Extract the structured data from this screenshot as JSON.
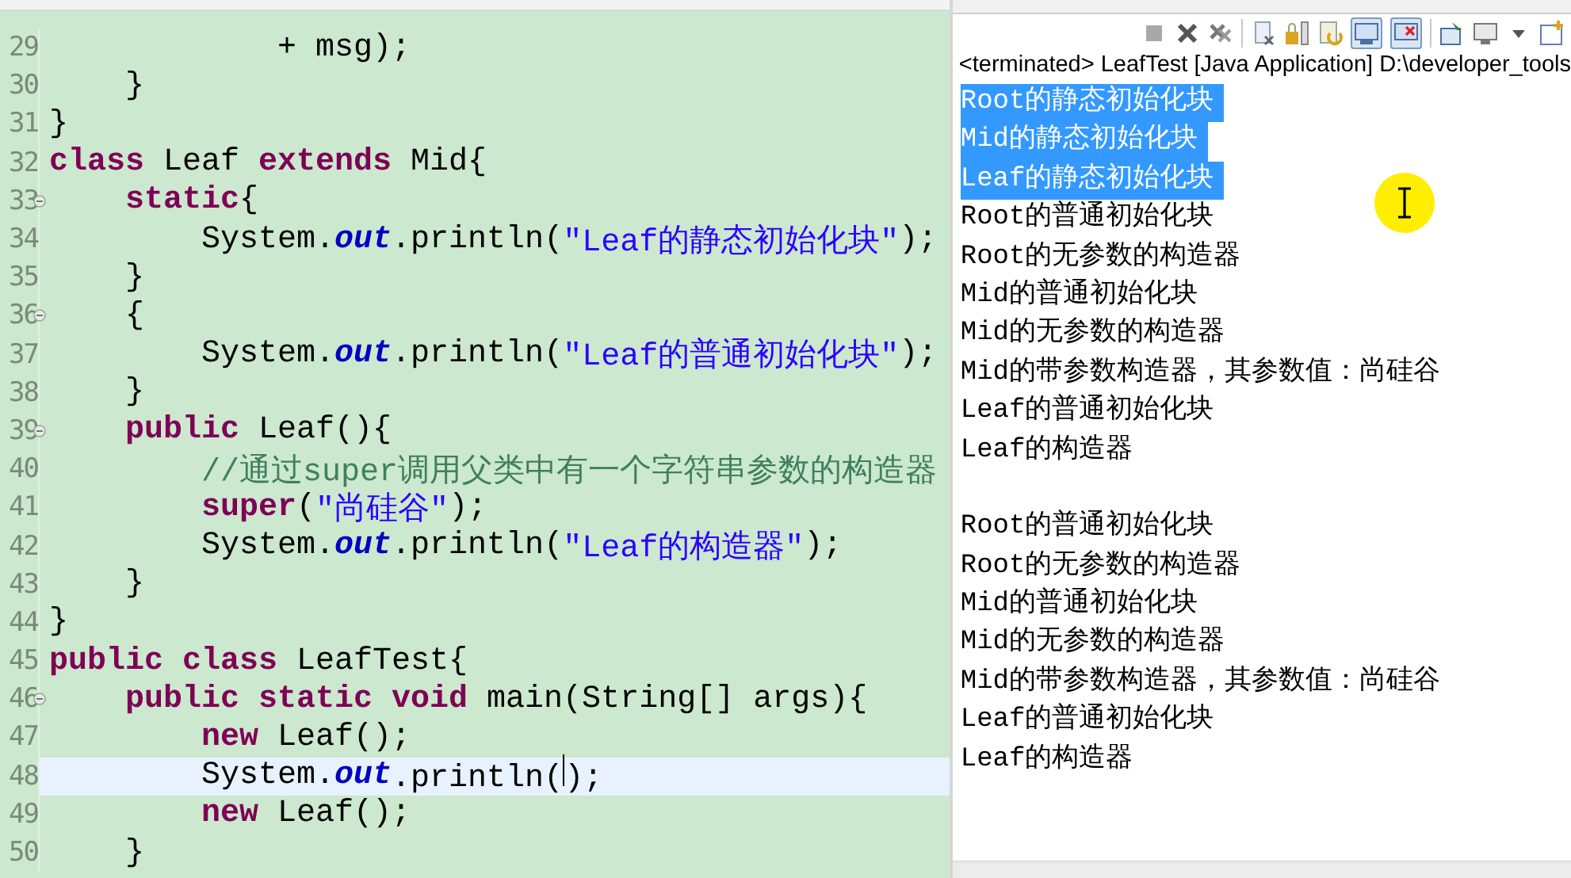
{
  "editor": {
    "lines": [
      {
        "number": "29",
        "fold": false,
        "current": false,
        "segments": [
          {
            "kind": "plain",
            "text": "            + msg);"
          }
        ]
      },
      {
        "number": "30",
        "fold": false,
        "current": false,
        "segments": [
          {
            "kind": "plain",
            "text": "    }"
          }
        ]
      },
      {
        "number": "31",
        "fold": false,
        "current": false,
        "segments": [
          {
            "kind": "plain",
            "text": "}"
          }
        ]
      },
      {
        "number": "32",
        "fold": false,
        "current": false,
        "segments": [
          {
            "kind": "keyword",
            "text": "class"
          },
          {
            "kind": "plain",
            "text": " Leaf "
          },
          {
            "kind": "keyword",
            "text": "extends"
          },
          {
            "kind": "plain",
            "text": " Mid{"
          }
        ]
      },
      {
        "number": "33",
        "fold": true,
        "current": false,
        "segments": [
          {
            "kind": "keyword",
            "text": "    static"
          },
          {
            "kind": "plain",
            "text": "{"
          }
        ]
      },
      {
        "number": "34",
        "fold": false,
        "current": false,
        "segments": [
          {
            "kind": "plain",
            "text": "        System."
          },
          {
            "kind": "field",
            "text": "out"
          },
          {
            "kind": "plain",
            "text": ".println("
          },
          {
            "kind": "string",
            "text": "\"Leaf的静态初始化块\""
          },
          {
            "kind": "plain",
            "text": ");"
          }
        ]
      },
      {
        "number": "35",
        "fold": false,
        "current": false,
        "segments": [
          {
            "kind": "plain",
            "text": "    }"
          }
        ]
      },
      {
        "number": "36",
        "fold": true,
        "current": false,
        "segments": [
          {
            "kind": "plain",
            "text": "    {"
          }
        ]
      },
      {
        "number": "37",
        "fold": false,
        "current": false,
        "segments": [
          {
            "kind": "plain",
            "text": "        System."
          },
          {
            "kind": "field",
            "text": "out"
          },
          {
            "kind": "plain",
            "text": ".println("
          },
          {
            "kind": "string",
            "text": "\"Leaf的普通初始化块\""
          },
          {
            "kind": "plain",
            "text": ");"
          }
        ]
      },
      {
        "number": "38",
        "fold": false,
        "current": false,
        "segments": [
          {
            "kind": "plain",
            "text": "    }"
          }
        ]
      },
      {
        "number": "39",
        "fold": true,
        "current": false,
        "segments": [
          {
            "kind": "keyword",
            "text": "    public"
          },
          {
            "kind": "plain",
            "text": " Leaf(){"
          }
        ]
      },
      {
        "number": "40",
        "fold": false,
        "current": false,
        "segments": [
          {
            "kind": "comment",
            "text": "        //通过super调用父类中有一个字符串参数的构造器"
          }
        ]
      },
      {
        "number": "41",
        "fold": false,
        "current": false,
        "segments": [
          {
            "kind": "keyword",
            "text": "        super"
          },
          {
            "kind": "plain",
            "text": "("
          },
          {
            "kind": "string",
            "text": "\"尚硅谷\""
          },
          {
            "kind": "plain",
            "text": ");"
          }
        ]
      },
      {
        "number": "42",
        "fold": false,
        "current": false,
        "segments": [
          {
            "kind": "plain",
            "text": "        System."
          },
          {
            "kind": "field",
            "text": "out"
          },
          {
            "kind": "plain",
            "text": ".println("
          },
          {
            "kind": "string",
            "text": "\"Leaf的构造器\""
          },
          {
            "kind": "plain",
            "text": ");"
          }
        ]
      },
      {
        "number": "43",
        "fold": false,
        "current": false,
        "segments": [
          {
            "kind": "plain",
            "text": "    }"
          }
        ]
      },
      {
        "number": "44",
        "fold": false,
        "current": false,
        "segments": [
          {
            "kind": "plain",
            "text": "}"
          }
        ]
      },
      {
        "number": "45",
        "fold": false,
        "current": false,
        "segments": [
          {
            "kind": "keyword",
            "text": "public class"
          },
          {
            "kind": "plain",
            "text": " LeafTest{"
          }
        ]
      },
      {
        "number": "46",
        "fold": true,
        "current": false,
        "segments": [
          {
            "kind": "keyword",
            "text": "    public static void"
          },
          {
            "kind": "plain",
            "text": " main(String[] args){"
          }
        ]
      },
      {
        "number": "47",
        "fold": false,
        "current": false,
        "segments": [
          {
            "kind": "keyword",
            "text": "        new"
          },
          {
            "kind": "plain",
            "text": " Leaf();"
          }
        ]
      },
      {
        "number": "48",
        "fold": false,
        "current": true,
        "segments": [
          {
            "kind": "plain",
            "text": "        System."
          },
          {
            "kind": "field",
            "text": "out"
          },
          {
            "kind": "plain",
            "text": ".println();"
          }
        ]
      },
      {
        "number": "49",
        "fold": false,
        "current": false,
        "segments": [
          {
            "kind": "keyword",
            "text": "        new"
          },
          {
            "kind": "plain",
            "text": " Leaf();"
          }
        ]
      },
      {
        "number": "50",
        "fold": false,
        "current": false,
        "segments": [
          {
            "kind": "plain",
            "text": "    }"
          }
        ]
      }
    ]
  },
  "console": {
    "header": "<terminated> LeafTest [Java Application] D:\\developer_tools",
    "groups": [
      {
        "lines": [
          {
            "text": "Root的静态初始化块",
            "selected": true
          },
          {
            "text": "Mid的静态初始化块",
            "selected": true
          },
          {
            "text": "Leaf的静态初始化块",
            "selected": true
          },
          {
            "text": "Root的普通初始化块",
            "selected": false
          },
          {
            "text": "Root的无参数的构造器",
            "selected": false
          },
          {
            "text": "Mid的普通初始化块",
            "selected": false
          },
          {
            "text": "Mid的无参数的构造器",
            "selected": false
          },
          {
            "text": "Mid的带参数构造器，其参数值：尚硅谷",
            "selected": false
          },
          {
            "text": "Leaf的普通初始化块",
            "selected": false
          },
          {
            "text": "Leaf的构造器",
            "selected": false
          }
        ]
      },
      {
        "lines": [
          {
            "text": "Root的普通初始化块",
            "selected": false
          },
          {
            "text": "Root的无参数的构造器",
            "selected": false
          },
          {
            "text": "Mid的普通初始化块",
            "selected": false
          },
          {
            "text": "Mid的无参数的构造器",
            "selected": false
          },
          {
            "text": "Mid的带参数构造器，其参数值：尚硅谷",
            "selected": false
          },
          {
            "text": "Leaf的普通初始化块",
            "selected": false
          },
          {
            "text": "Leaf的构造器",
            "selected": false
          }
        ]
      }
    ]
  }
}
